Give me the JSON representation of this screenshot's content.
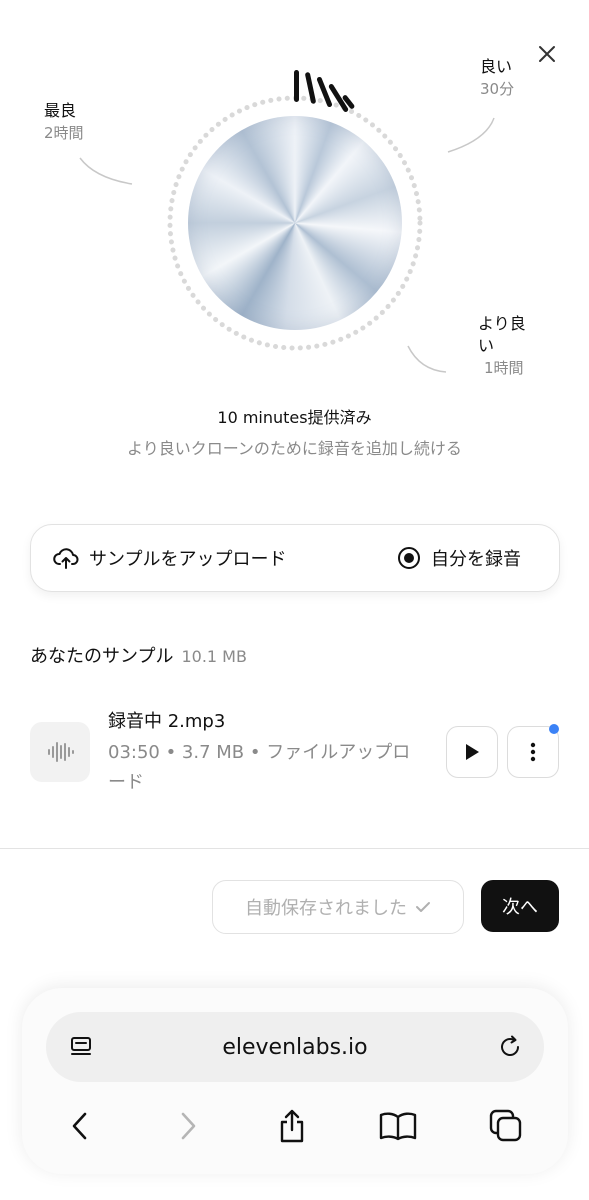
{
  "quality": {
    "best": {
      "label": "最良",
      "time": "2時間"
    },
    "good": {
      "label": "良い",
      "time": "30分"
    },
    "better": {
      "label": "より良い",
      "time": "1時間"
    }
  },
  "progress": {
    "provided": "10 minutes提供済み",
    "hint": "より良いクローンのために録音を追加し続ける"
  },
  "actions": {
    "upload_label": "サンプルをアップロード",
    "record_label": "自分を録音"
  },
  "samples": {
    "title": "あなたのサンプル",
    "size": "10.1 MB",
    "items": [
      {
        "name": "録音中 2.mp3",
        "meta": "03:50 • 3.7 MB • ファイルアップロード"
      }
    ]
  },
  "footer": {
    "autosave_label": "自動保存されました",
    "next_label": "次へ"
  },
  "browser": {
    "url": "elevenlabs.io"
  },
  "colors": {
    "accent_dot": "#3b82f6",
    "primary_button": "#111111"
  }
}
